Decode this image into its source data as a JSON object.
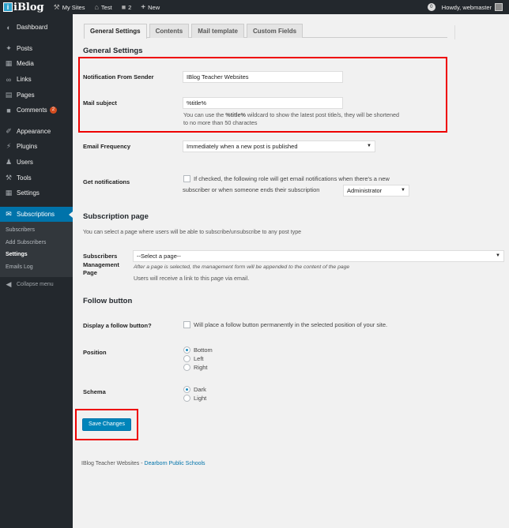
{
  "adminbar": {
    "site_logo": "iBlog",
    "my_sites": "My Sites",
    "site_name": "Test",
    "comments_count": "2",
    "new_label": "New",
    "notifications": "0",
    "howdy": "Howdy, webmaster"
  },
  "sidebar": {
    "items": [
      {
        "label": "Dashboard",
        "icon": "dashboard-icon"
      },
      {
        "label": "Posts",
        "icon": "pin-icon"
      },
      {
        "label": "Media",
        "icon": "media-icon"
      },
      {
        "label": "Links",
        "icon": "link-icon"
      },
      {
        "label": "Pages",
        "icon": "page-icon"
      },
      {
        "label": "Comments",
        "icon": "comment-icon",
        "badge": "2"
      },
      {
        "label": "Appearance",
        "icon": "brush-icon"
      },
      {
        "label": "Plugins",
        "icon": "plugin-icon"
      },
      {
        "label": "Users",
        "icon": "user-icon"
      },
      {
        "label": "Tools",
        "icon": "wrench-icon"
      },
      {
        "label": "Settings",
        "icon": "settings-icon"
      },
      {
        "label": "Subscriptions",
        "icon": "mail-icon"
      }
    ],
    "sub_items": [
      "Subscribers",
      "Add Subscribers",
      "Settings",
      "Emails Log"
    ],
    "collapse": "Collapse menu"
  },
  "tabs": [
    "General Settings",
    "Contents",
    "Mail template",
    "Custom Fields"
  ],
  "general": {
    "heading": "General Settings",
    "sender_label": "Notification From Sender",
    "sender_value": "IBlog Teacher Websites",
    "subject_label": "Mail subject",
    "subject_value": "%title%",
    "subject_desc_1": "You can use the",
    "subject_desc_bold": "%title%",
    "subject_desc_2": "wildcard to show the latest post title/s, they will be shortened",
    "subject_desc_3": "to no more than 50 charactes",
    "frequency_label": "Email Frequency",
    "frequency_value": "Immediately when a new post is published",
    "notif_label": "Get notifications",
    "notif_desc_1": "If checked, the following role will get email notifications when there's a new",
    "notif_desc_2": "subscriber or when someone ends their subscription",
    "role_value": "Administrator"
  },
  "subscription_page": {
    "heading": "Subscription page",
    "intro": "You can select a page where users will be able to subscribe/unsubscribe to any post type",
    "label_1": "Subscribers",
    "label_2": "Management",
    "label_3": "Page",
    "select_value": "--Select a page--",
    "note": "After a page is selected, the management form will be appended to the content of the page",
    "note2": "Users will receive a link to this page via email."
  },
  "follow": {
    "heading": "Follow button",
    "display_label": "Display a follow button?",
    "display_desc": "Will place a follow button permanently in the selected position of your site.",
    "position_label": "Position",
    "positions": [
      "Bottom",
      "Left",
      "Right"
    ],
    "schema_label": "Schema",
    "schemas": [
      "Dark",
      "Light"
    ]
  },
  "save_label": "Save Changes",
  "footer": {
    "text": "IBlog Teacher Websites - ",
    "link": "Dearborn Public Schools"
  }
}
